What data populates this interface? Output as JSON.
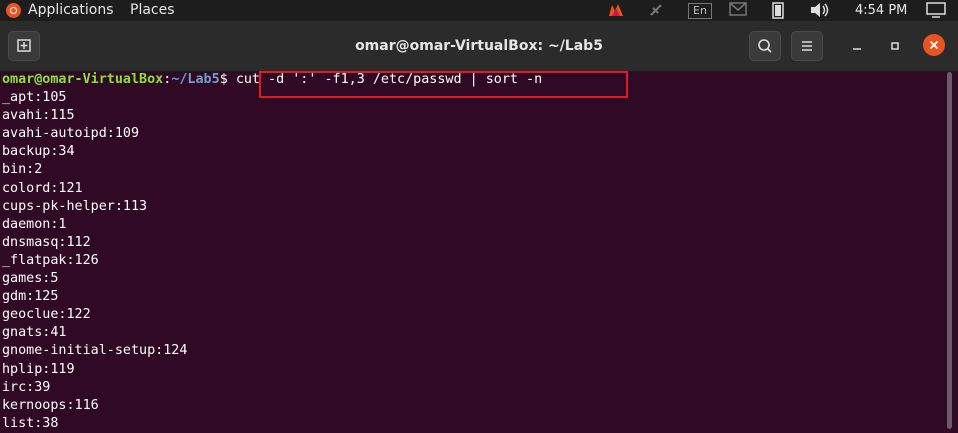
{
  "topbar": {
    "applications": "Applications",
    "places": "Places",
    "keyboard": "En",
    "clock": "4:54 PM"
  },
  "window": {
    "title": "omar@omar-VirtualBox: ~/Lab5"
  },
  "terminal": {
    "prompt_user": "omar@omar-VirtualBox",
    "prompt_sep": ":",
    "prompt_path": "~/Lab5",
    "prompt_end": "$ ",
    "command": "cut -d ':' -f1,3 /etc/passwd | sort -n",
    "output": [
      "_apt:105",
      "avahi:115",
      "avahi-autoipd:109",
      "backup:34",
      "bin:2",
      "colord:121",
      "cups-pk-helper:113",
      "daemon:1",
      "dnsmasq:112",
      "_flatpak:126",
      "games:5",
      "gdm:125",
      "geoclue:122",
      "gnats:41",
      "gnome-initial-setup:124",
      "hplip:119",
      "irc:39",
      "kernoops:116",
      "list:38"
    ]
  },
  "colors": {
    "terminal_bg": "#300a24",
    "prompt_user": "#8ae234",
    "prompt_path": "#729fcf",
    "highlight_box": "#e01b24",
    "close_button": "#e95420"
  }
}
